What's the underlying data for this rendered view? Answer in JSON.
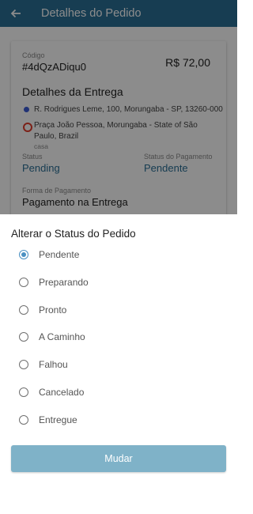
{
  "app_bar": {
    "title": "Detalhes do Pedido",
    "back_icon": "arrow-left-icon"
  },
  "order": {
    "code_label": "Código",
    "code": "#4dQzADiqu0",
    "total": "R$ 72,00",
    "delivery_title": "Detalhes da Entrega",
    "pickup_address": "R. Rodrigues Leme, 100, Morungaba - SP, 13260-000",
    "dropoff_address_line1": "Praça João Pessoa, Morungaba - State of São",
    "dropoff_address_line2": "Paulo, Brazil",
    "dropoff_tag": "casa",
    "status_label": "Status",
    "status_value": "Pending",
    "payment_status_label": "Status do Pagamento",
    "payment_status_value": "Pendente",
    "payment_method_label": "Forma de Pagamento",
    "payment_method_value": "Pagamento na Entrega"
  },
  "sheet": {
    "title": "Alterar o Status do Pedido",
    "options": [
      {
        "label": "Pendente",
        "selected": true
      },
      {
        "label": "Preparando",
        "selected": false
      },
      {
        "label": "Pronto",
        "selected": false
      },
      {
        "label": "A Caminho",
        "selected": false
      },
      {
        "label": "Falhou",
        "selected": false
      },
      {
        "label": "Cancelado",
        "selected": false
      },
      {
        "label": "Entregue",
        "selected": false
      }
    ],
    "submit_label": "Mudar"
  },
  "colors": {
    "primary": "#2b6f96",
    "radio_selected": "#4a90c2",
    "button": "#7fb2c8",
    "pickup_dot": "#3b5bd6",
    "dropoff_dot": "#e23c2c"
  }
}
